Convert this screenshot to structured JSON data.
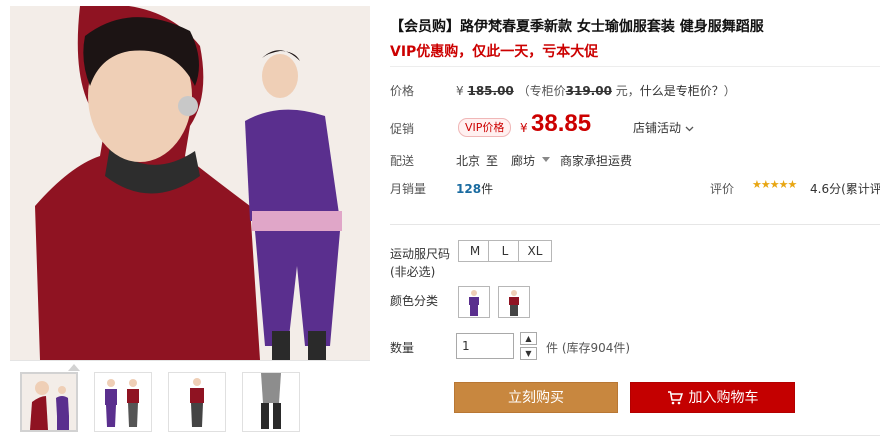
{
  "product": {
    "title": "【会员购】路伊梵春夏季新款 女士瑜伽服套装 健身服舞蹈服",
    "subtitle": "VIP优惠购，仅此一天，亏本大促"
  },
  "price": {
    "label": "价格",
    "yen": "¥",
    "original": "185.00",
    "counter_prefix": "（专柜价",
    "counter_price": "319.00",
    "counter_unit": " 元，",
    "counter_link": "什么是专柜价？",
    "counter_suffix": "）"
  },
  "promo": {
    "label": "促销",
    "badge": "VIP价格",
    "yen": "¥",
    "price": "38.85",
    "store_activity": "店铺活动"
  },
  "shipping": {
    "label": "配送",
    "from": "北京",
    "to": "至",
    "dest": "廊坊",
    "fee": "商家承担运费"
  },
  "sales": {
    "label": "月销量",
    "count": "128",
    "unit": "件"
  },
  "rating": {
    "label": "评价",
    "stars": "★★★★★",
    "score": "4.6分",
    "link": "(累计评"
  },
  "size": {
    "label": "运动服尺码",
    "note": "(非必选)",
    "options": [
      "M",
      "L",
      "XL"
    ]
  },
  "color": {
    "label": "颜色分类"
  },
  "quantity": {
    "label": "数量",
    "value": "1",
    "up": "▲",
    "down": "▼",
    "stock_unit": "件",
    "stock": "(库存904件)"
  },
  "buttons": {
    "buy": "立刻购买",
    "cart": "加入购物车"
  },
  "colors": {
    "accent_red": "#cc0000",
    "buy_orange": "#c8873f",
    "cart_red": "#c40000",
    "sales_blue": "#1a6ba0"
  }
}
